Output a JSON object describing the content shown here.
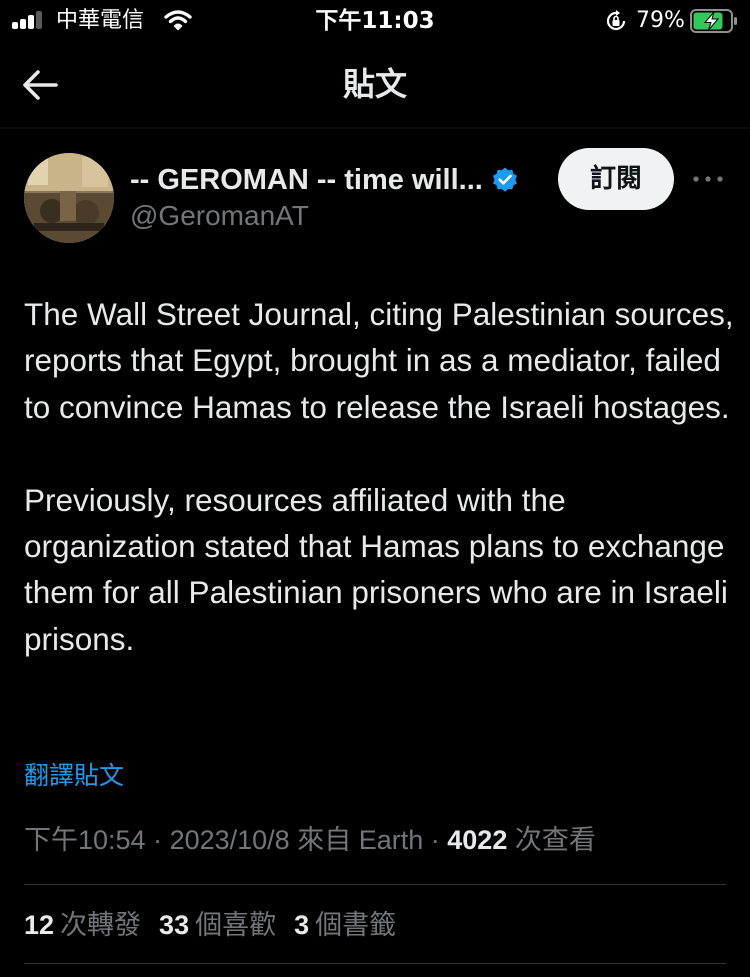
{
  "status_bar": {
    "carrier": "中華電信",
    "time": "下午11:03",
    "battery_percent": "79%",
    "charging": true,
    "icons": [
      "signal-icon",
      "wifi-icon",
      "rotation-lock-icon",
      "battery-charging-icon"
    ]
  },
  "header": {
    "back_icon": "arrow-left-icon",
    "title": "貼文"
  },
  "author": {
    "display_name": "-- GEROMAN -- time will...",
    "handle": "@GeromanAT",
    "verified": true,
    "subscribe_label": "訂閱",
    "more_icon": "more-horizontal-icon"
  },
  "tweet": {
    "paragraphs": [
      "The Wall Street Journal, citing Palestinian sources, reports that Egypt, brought in as a mediator, failed to convince Hamas to release the Israeli hostages.",
      "Previously, resources affiliated with the organization stated that Hamas plans to exchange them for all Palestinian prisoners who are in Israeli prisons."
    ],
    "translate_label": "翻譯貼文"
  },
  "meta": {
    "time": "下午10:54",
    "sep1": " · ",
    "date": "2023/10/8",
    "source_prefix": " 來自 ",
    "source": "Earth",
    "sep2": " · ",
    "views_count": "4022",
    "views_label": " 次查看"
  },
  "stats": {
    "retweets_count": "12",
    "retweets_label": "次轉發",
    "likes_count": "33",
    "likes_label": "個喜歡",
    "bookmarks_count": "3",
    "bookmarks_label": "個書籤"
  },
  "colors": {
    "background": "#000000",
    "text": "#e7e9ea",
    "secondary_text": "#71767b",
    "link": "#1d9bf0",
    "verified_badge": "#1d9bf0",
    "subscribe_bg": "#eff3f4",
    "divider": "#2f3336",
    "battery_charge": "#34c759"
  }
}
